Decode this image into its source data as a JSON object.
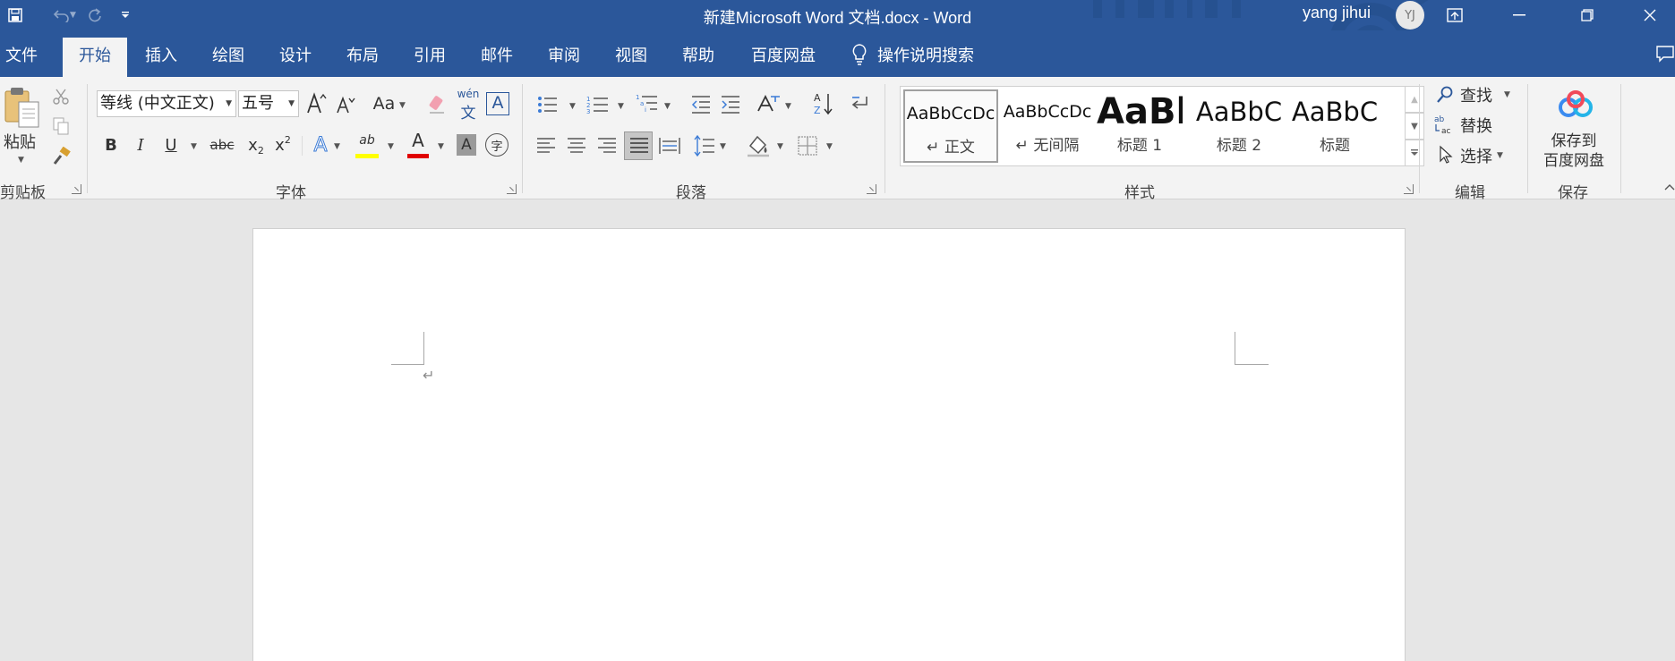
{
  "window": {
    "title": "新建Microsoft Word 文档.docx  -  Word",
    "user_name": "yang jihui",
    "user_initials": "YJ"
  },
  "icons": {
    "save": "save-icon",
    "undo": "undo-icon",
    "redo": "redo-icon",
    "customize": "customize-qat-icon",
    "ribbon_display": "ribbon-display-options-icon",
    "minimize": "minimize-icon",
    "restore": "restore-icon",
    "close": "close-icon",
    "tell_me": "lightbulb-icon",
    "comments": "comments-icon"
  },
  "tabs": [
    {
      "label": "文件"
    },
    {
      "label": "开始",
      "active": true
    },
    {
      "label": "插入"
    },
    {
      "label": "绘图"
    },
    {
      "label": "设计"
    },
    {
      "label": "布局"
    },
    {
      "label": "引用"
    },
    {
      "label": "邮件"
    },
    {
      "label": "审阅"
    },
    {
      "label": "视图"
    },
    {
      "label": "帮助"
    },
    {
      "label": "百度网盘"
    }
  ],
  "tell_me": "操作说明搜索",
  "clipboard": {
    "paste_label": "粘贴",
    "group_label": "剪贴板"
  },
  "font": {
    "font_name": "等线 (中文正文)",
    "font_size": "五号",
    "change_case": "Aa",
    "phonetic_top": "wén",
    "phonetic_bottom": "文",
    "border_char": "A",
    "bold": "B",
    "italic": "I",
    "underline": "U",
    "strike": "abc",
    "subscript": "x",
    "sub_mark": "2",
    "superscript": "x",
    "sup_mark": "2",
    "highlight_text": "ab",
    "font_color_text": "A",
    "char_shading_text": "A",
    "enclose_text": "字",
    "highlight_color": "#ffff00",
    "font_color": "#e00000",
    "group_label": "字体"
  },
  "paragraph": {
    "group_label": "段落"
  },
  "styles": {
    "items": [
      {
        "sample": "AaBbCcDc",
        "name": "↵ 正文"
      },
      {
        "sample": "AaBbCcDc",
        "name": "↵ 无间隔"
      },
      {
        "sample": "AaBl",
        "name": "标题 1"
      },
      {
        "sample": "AaBbC",
        "name": "标题 2"
      },
      {
        "sample": "AaBbC",
        "name": "标题"
      }
    ],
    "group_label": "样式"
  },
  "editing": {
    "find": "查找",
    "replace": "替换",
    "select": "选择",
    "group_label": "编辑"
  },
  "save_group": {
    "button_line1": "保存到",
    "button_line2": "百度网盘",
    "group_label": "保存"
  },
  "document": {
    "para_mark": "↵"
  },
  "colors": {
    "title_bar": "#2b579a",
    "ribbon": "#f3f3f3",
    "canvas": "#e6e6e6",
    "page": "#ffffff"
  }
}
